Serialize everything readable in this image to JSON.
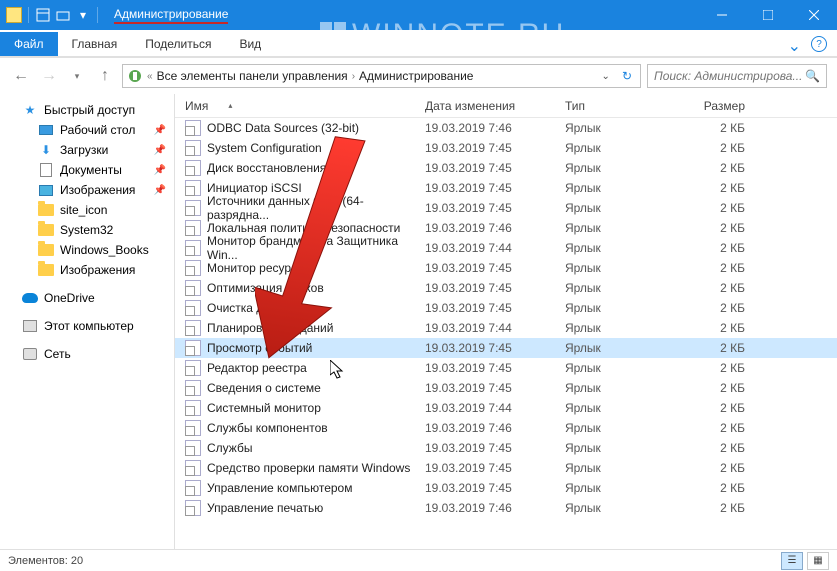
{
  "title": "Администрирование",
  "watermark": "WINNOTE.RU",
  "ribbon": {
    "file": "Файл",
    "tabs": [
      "Главная",
      "Поделиться",
      "Вид"
    ]
  },
  "breadcrumb": {
    "seg1": "Все элементы панели управления",
    "seg2": "Администрирование"
  },
  "search_placeholder": "Поиск: Администрирова...",
  "columns": {
    "name": "Имя",
    "date": "Дата изменения",
    "type": "Тип",
    "size": "Размер"
  },
  "sidebar": {
    "quick": "Быстрый доступ",
    "quick_items": [
      {
        "label": "Рабочий стол",
        "pin": true,
        "icon": "desktop"
      },
      {
        "label": "Загрузки",
        "pin": true,
        "icon": "downloads"
      },
      {
        "label": "Документы",
        "pin": true,
        "icon": "docs"
      },
      {
        "label": "Изображения",
        "pin": true,
        "icon": "pictures"
      },
      {
        "label": "site_icon",
        "pin": false,
        "icon": "folder"
      },
      {
        "label": "System32",
        "pin": false,
        "icon": "folder"
      },
      {
        "label": "Windows_Books",
        "pin": false,
        "icon": "folder"
      },
      {
        "label": "Изображения",
        "pin": false,
        "icon": "folder"
      }
    ],
    "onedrive": "OneDrive",
    "thispc": "Этот компьютер",
    "network": "Сеть"
  },
  "files": [
    {
      "name": "ODBC Data Sources (32-bit)",
      "date": "19.03.2019 7:46",
      "type": "Ярлык",
      "size": "2 КБ"
    },
    {
      "name": "System Configuration",
      "date": "19.03.2019 7:45",
      "type": "Ярлык",
      "size": "2 КБ"
    },
    {
      "name": "Диск восстановления",
      "date": "19.03.2019 7:45",
      "type": "Ярлык",
      "size": "2 КБ"
    },
    {
      "name": "Инициатор iSCSI",
      "date": "19.03.2019 7:45",
      "type": "Ярлык",
      "size": "2 КБ"
    },
    {
      "name": "Источники данных ОРС (64-разрядна...",
      "date": "19.03.2019 7:45",
      "type": "Ярлык",
      "size": "2 КБ"
    },
    {
      "name": "Локальная политика безопасности",
      "date": "19.03.2019 7:46",
      "type": "Ярлык",
      "size": "2 КБ"
    },
    {
      "name": "Монитор брандмауэра Защитника Win...",
      "date": "19.03.2019 7:44",
      "type": "Ярлык",
      "size": "2 КБ"
    },
    {
      "name": "Монитор ресурсов",
      "date": "19.03.2019 7:45",
      "type": "Ярлык",
      "size": "2 КБ"
    },
    {
      "name": "Оптимизация дисков",
      "date": "19.03.2019 7:45",
      "type": "Ярлык",
      "size": "2 КБ"
    },
    {
      "name": "Очистка диска",
      "date": "19.03.2019 7:45",
      "type": "Ярлык",
      "size": "2 КБ"
    },
    {
      "name": "Планировщик заданий",
      "date": "19.03.2019 7:44",
      "type": "Ярлык",
      "size": "2 КБ"
    },
    {
      "name": "Просмотр событий",
      "date": "19.03.2019 7:45",
      "type": "Ярлык",
      "size": "2 КБ",
      "selected": true
    },
    {
      "name": "Редактор реестра",
      "date": "19.03.2019 7:45",
      "type": "Ярлык",
      "size": "2 КБ"
    },
    {
      "name": "Сведения о системе",
      "date": "19.03.2019 7:45",
      "type": "Ярлык",
      "size": "2 КБ"
    },
    {
      "name": "Системный монитор",
      "date": "19.03.2019 7:44",
      "type": "Ярлык",
      "size": "2 КБ"
    },
    {
      "name": "Службы компонентов",
      "date": "19.03.2019 7:46",
      "type": "Ярлык",
      "size": "2 КБ"
    },
    {
      "name": "Службы",
      "date": "19.03.2019 7:45",
      "type": "Ярлык",
      "size": "2 КБ"
    },
    {
      "name": "Средство проверки памяти Windows",
      "date": "19.03.2019 7:45",
      "type": "Ярлык",
      "size": "2 КБ"
    },
    {
      "name": "Управление компьютером",
      "date": "19.03.2019 7:45",
      "type": "Ярлык",
      "size": "2 КБ"
    },
    {
      "name": "Управление печатью",
      "date": "19.03.2019 7:46",
      "type": "Ярлык",
      "size": "2 КБ"
    }
  ],
  "status": "Элементов: 20"
}
